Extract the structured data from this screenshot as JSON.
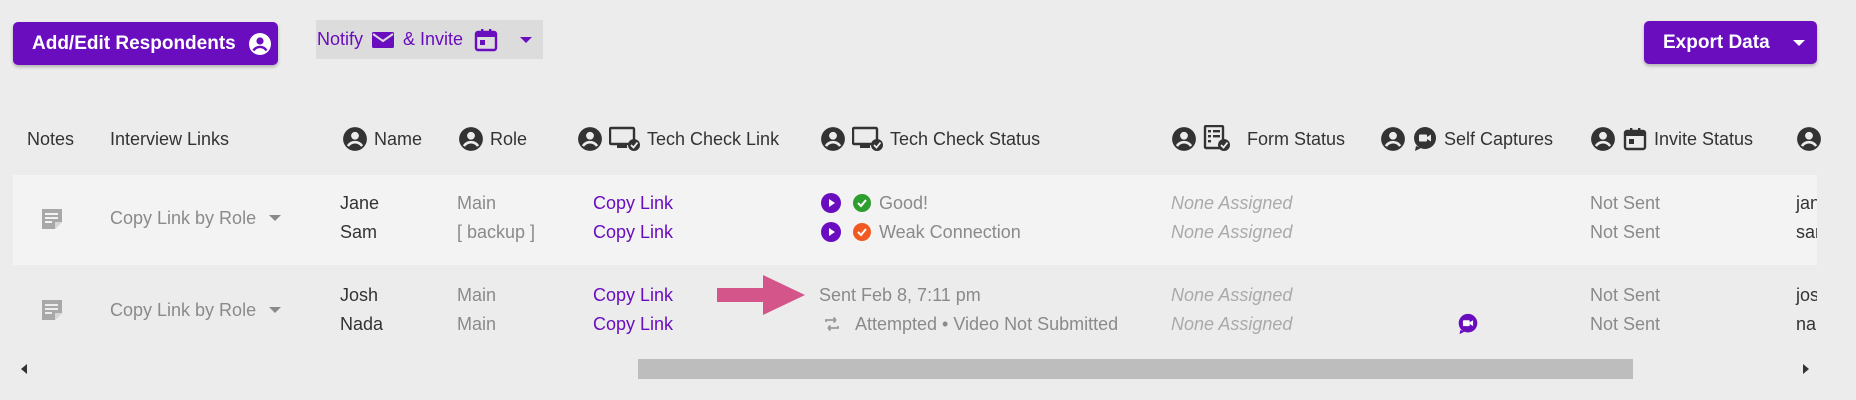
{
  "toolbar": {
    "add_edit_label": "Add/Edit Respondents",
    "notify_label": "Notify",
    "invite_label": "& Invite",
    "export_label": "Export Data"
  },
  "columns": {
    "notes": "Notes",
    "interview_links": "Interview Links",
    "name": "Name",
    "role": "Role",
    "tech_check_link": "Tech Check Link",
    "tech_check_status": "Tech Check Status",
    "form_status": "Form Status",
    "self_captures": "Self Captures",
    "invite_status": "Invite Status"
  },
  "groups": [
    {
      "copy_link_label": "Copy Link by Role",
      "rows": [
        {
          "name": "Jane",
          "role": "Main",
          "tech_link": "Copy Link",
          "tech_status": "Good!",
          "form_status": "None Assigned",
          "invite_status": "Not Sent",
          "email": "jan"
        },
        {
          "name": "Sam",
          "role": "[ backup ]",
          "tech_link": "Copy Link",
          "tech_status": "Weak Connection",
          "form_status": "None Assigned",
          "invite_status": "Not Sent",
          "email": "sar"
        }
      ]
    },
    {
      "copy_link_label": "Copy Link by Role",
      "rows": [
        {
          "name": "Josh",
          "role": "Main",
          "tech_link": "Copy Link",
          "tech_status": "Sent Feb 8, 7:11 pm",
          "form_status": "None Assigned",
          "invite_status": "Not Sent",
          "email": "jos"
        },
        {
          "name": "Nada",
          "role": "Main",
          "tech_link": "Copy Link",
          "tech_status": "Attempted • Video Not Submitted",
          "form_status": "None Assigned",
          "invite_status": "Not Sent",
          "email": "na"
        }
      ]
    }
  ],
  "colors": {
    "accent": "#6a0dbf",
    "good": "#2e9e2e",
    "warning": "#f05a22",
    "annotation_arrow": "#d4558a"
  },
  "icons": [
    "avatar-icon",
    "envelope-icon",
    "calendar-icon",
    "caret-down-icon",
    "monitor-check-icon",
    "form-check-icon",
    "video-chat-icon",
    "note-icon",
    "play-icon",
    "check-circle-icon",
    "retry-icon"
  ]
}
